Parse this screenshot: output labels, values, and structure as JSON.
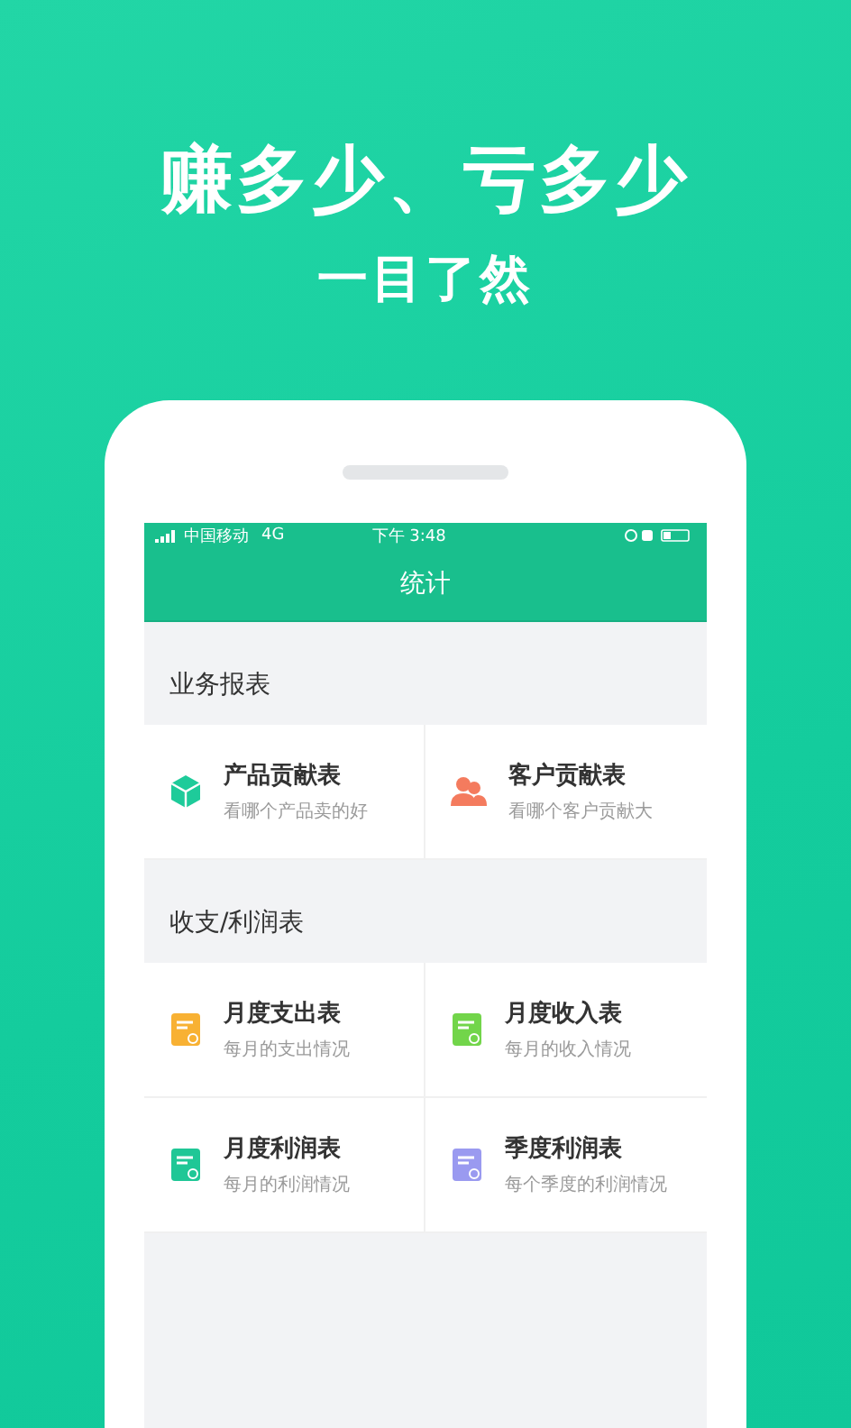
{
  "headline": "赚多少、亏多少",
  "subheadline": "一目了然",
  "status_bar": {
    "carrier": "中国移动",
    "network": "4G",
    "time": "下午 3:48"
  },
  "nav": {
    "title": "统计"
  },
  "sections": [
    {
      "title": "业务报表",
      "items": [
        {
          "kind": "cube",
          "color": "#1ecb9a",
          "title": "产品贡献表",
          "subtitle": "看哪个产品卖的好"
        },
        {
          "kind": "people",
          "color": "#f47b5e",
          "title": "客户贡献表",
          "subtitle": "看哪个客户贡献大"
        }
      ]
    },
    {
      "title": "收支/利润表",
      "items": [
        {
          "kind": "sheet",
          "color": "#f8b133",
          "title": "月度支出表",
          "subtitle": "每月的支出情况"
        },
        {
          "kind": "sheet",
          "color": "#72d54a",
          "title": "月度收入表",
          "subtitle": "每月的收入情况"
        },
        {
          "kind": "sheet",
          "color": "#1fc796",
          "title": "月度利润表",
          "subtitle": "每月的利润情况"
        },
        {
          "kind": "sheet",
          "color": "#9a9af0",
          "title": "季度利润表",
          "subtitle": "每个季度的利润情况"
        }
      ]
    }
  ]
}
